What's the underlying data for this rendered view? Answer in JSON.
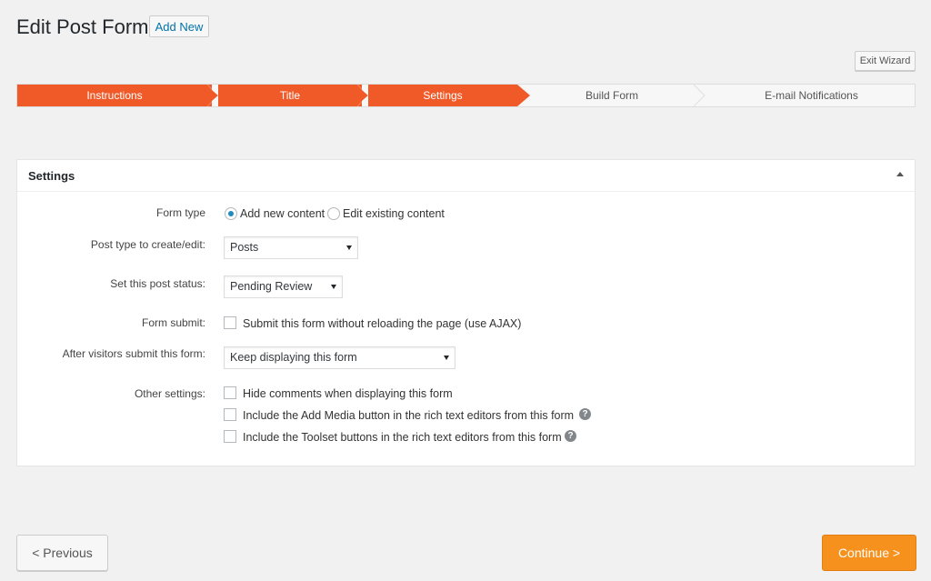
{
  "header": {
    "title": "Edit Post Form",
    "add_new_label": "Add New",
    "exit_wizard_label": "Exit Wizard"
  },
  "colors": {
    "step_done": "#f05a28",
    "continue_button": "#f6911e",
    "link": "#0073aa"
  },
  "wizard": {
    "steps": [
      {
        "label": "Instructions",
        "state": "done"
      },
      {
        "label": "Title",
        "state": "done"
      },
      {
        "label": "Settings",
        "state": "current"
      },
      {
        "label": "Build Form",
        "state": "todo"
      },
      {
        "label": "E-mail Notifications",
        "state": "todo"
      }
    ]
  },
  "settings": {
    "panel_title": "Settings",
    "form_type": {
      "label": "Form type",
      "options": [
        "Add new content",
        "Edit existing content"
      ],
      "selected": "Add new content"
    },
    "post_type": {
      "label": "Post type to create/edit:",
      "value": "Posts"
    },
    "post_status": {
      "label": "Set this post status:",
      "value": "Pending Review"
    },
    "form_submit": {
      "label": "Form submit:",
      "option": "Submit this form without reloading the page (use AJAX)",
      "checked": false
    },
    "after_submit": {
      "label": "After visitors submit this form:",
      "value": "Keep displaying this form"
    },
    "other": {
      "label": "Other settings:",
      "options": [
        {
          "text": "Hide comments when displaying this form",
          "checked": false,
          "help": false
        },
        {
          "text": "Include the Add Media button in the rich text editors from this form",
          "checked": false,
          "help": true
        },
        {
          "text": "Include the Toolset buttons in the rich text editors from this form",
          "checked": false,
          "help": true
        }
      ]
    }
  },
  "footer": {
    "previous_label": "< Previous",
    "continue_label": "Continue >"
  },
  "icons": {
    "help": "question-circle-icon",
    "toggle": "caret-up-icon",
    "select": "caret-down-icon"
  }
}
